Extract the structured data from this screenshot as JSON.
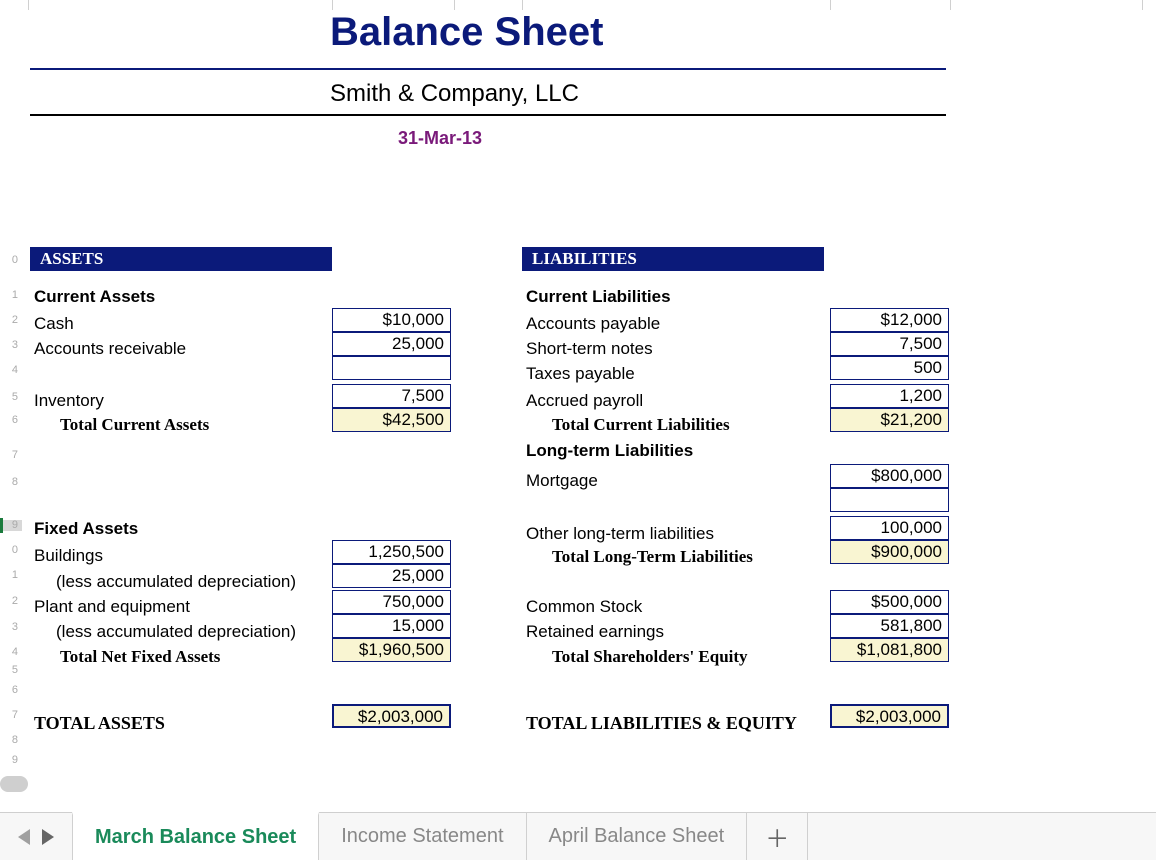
{
  "title": "Balance Sheet",
  "company": "Smith & Company, LLC",
  "asof": "31-Mar-13",
  "headers": {
    "assets": "ASSETS",
    "liabilities": "LIABILITIES"
  },
  "section_labels": {
    "current_assets": "Current Assets",
    "fixed_assets": "Fixed Assets",
    "current_liab": "Current Liabilities",
    "longterm_liab": "Long-term Liabilities"
  },
  "assets": {
    "current": {
      "cash": {
        "label": "Cash",
        "value": "$10,000"
      },
      "ar": {
        "label": "Accounts receivable",
        "value": "25,000"
      },
      "inventory": {
        "label": "Inventory",
        "value": "7,500"
      },
      "total": {
        "label": "Total Current Assets",
        "value": "$42,500"
      }
    },
    "fixed": {
      "buildings": {
        "label": "Buildings",
        "value": "1,250,500"
      },
      "buildings_dep": {
        "label": "(less accumulated depreciation)",
        "value": "25,000"
      },
      "plant": {
        "label": "Plant and equipment",
        "value": "750,000"
      },
      "plant_dep": {
        "label": "(less accumulated depreciation)",
        "value": "15,000"
      },
      "total": {
        "label": "Total Net Fixed Assets",
        "value": "$1,960,500"
      }
    },
    "grand": {
      "label": "TOTAL ASSETS",
      "value": "$2,003,000"
    }
  },
  "liabilities": {
    "current": {
      "ap": {
        "label": "Accounts payable",
        "value": "$12,000"
      },
      "stn": {
        "label": "Short-term notes",
        "value": "7,500"
      },
      "taxes": {
        "label": "Taxes payable",
        "value": "500"
      },
      "accr": {
        "label": "Accrued payroll",
        "value": "1,200"
      },
      "total": {
        "label": "Total Current Liabilities",
        "value": "$21,200"
      }
    },
    "longterm": {
      "mortgage": {
        "label": "Mortgage",
        "value": "$800,000"
      },
      "other": {
        "label": "Other long-term liabilities",
        "value": "100,000"
      },
      "total": {
        "label": "Total Long-Term Liabilities",
        "value": "$900,000"
      }
    },
    "equity": {
      "cs": {
        "label": "Common Stock",
        "value": "$500,000"
      },
      "re": {
        "label": "Retained earnings",
        "value": "581,800"
      },
      "total": {
        "label": "Total Shareholders' Equity",
        "value": "$1,081,800"
      }
    },
    "grand": {
      "label": "TOTAL LIABILITIES & EQUITY",
      "value": "$2,003,000"
    }
  },
  "tabs": {
    "march": "March Balance Sheet",
    "income": "Income Statement",
    "april": "April Balance Sheet",
    "add": "＋"
  },
  "gutter_rows": [
    "",
    "",
    "",
    "",
    "",
    "",
    "",
    "",
    "",
    "0",
    "1",
    "2",
    "3",
    "4",
    "5",
    "6",
    "7",
    "8",
    "9",
    "0",
    "1",
    "2",
    "3",
    "4",
    "5",
    "6",
    "7",
    "8",
    "9"
  ]
}
